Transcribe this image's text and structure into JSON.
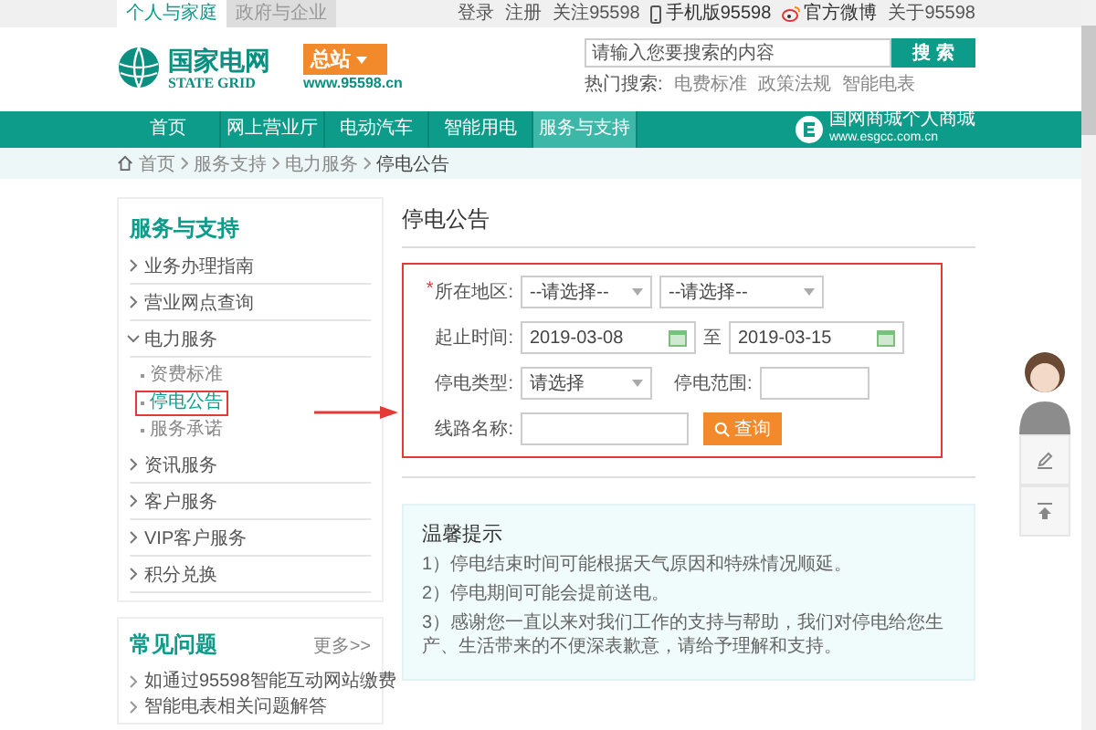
{
  "top_bar": {
    "tabs": [
      {
        "label": "个人与家庭",
        "selected": true
      },
      {
        "label": "政府与企业",
        "selected": false
      }
    ],
    "links": [
      {
        "label": "登录",
        "kind": "plain"
      },
      {
        "label": "注册",
        "kind": "plain"
      },
      {
        "label": "关注95598",
        "kind": "plain"
      },
      {
        "label": "手机版95598",
        "kind": "phone"
      },
      {
        "label": "官方微博",
        "kind": "weibo"
      },
      {
        "label": "关于95598",
        "kind": "plain"
      }
    ]
  },
  "header": {
    "logo_cn": "国家电网",
    "logo_en": "STATE GRID",
    "site_badge": "总站",
    "site_url": "www.95598.cn",
    "search": {
      "placeholder": "请输入您要搜索的内容",
      "button": "搜 索"
    },
    "hot_label": "热门搜索:",
    "hot_terms": [
      "电费标准",
      "政策法规",
      "智能电表"
    ]
  },
  "nav": {
    "items": [
      {
        "label": "首页",
        "selected": false
      },
      {
        "label": "网上营业厅",
        "selected": false
      },
      {
        "label": "电动汽车",
        "selected": false
      },
      {
        "label": "智能用电",
        "selected": false
      },
      {
        "label": "服务与支持",
        "selected": true
      }
    ],
    "mall": {
      "name": "国网商城个人商城",
      "url": "www.esgcc.com.cn"
    }
  },
  "breadcrumb": [
    "首页",
    "服务支持",
    "电力服务",
    "停电公告"
  ],
  "sidebar": {
    "title": "服务与支持",
    "items": [
      {
        "label": "业务办理指南",
        "expanded": false
      },
      {
        "label": "营业网点查询",
        "expanded": false
      },
      {
        "label": "电力服务",
        "expanded": true,
        "children": [
          {
            "label": "资费标准",
            "selected": false,
            "highlighted": false
          },
          {
            "label": "停电公告",
            "selected": true,
            "highlighted": true
          },
          {
            "label": "服务承诺",
            "selected": false,
            "highlighted": false
          }
        ]
      },
      {
        "label": "资讯服务",
        "expanded": false
      },
      {
        "label": "客户服务",
        "expanded": false
      },
      {
        "label": "VIP客户服务",
        "expanded": false
      },
      {
        "label": "积分兑换",
        "expanded": false
      }
    ]
  },
  "faq": {
    "title": "常见问题",
    "more": "更多>>",
    "items": [
      "如通过95598智能互动网站缴费",
      "智能电表相关问题解答"
    ]
  },
  "main": {
    "title": "停电公告",
    "form": {
      "highlighted": true,
      "required_mark": "*",
      "region_label": "所在地区:",
      "region_selects": [
        "--请选择--",
        "--请选择--"
      ],
      "date_label": "起止时间:",
      "date_from": "2019-03-08",
      "date_sep": "至",
      "date_to": "2019-03-15",
      "type_label": "停电类型:",
      "type_select": "请选择",
      "range_label": "停电范围:",
      "line_label": "线路名称:",
      "query_button": "查询"
    },
    "tips": {
      "title": "温馨提示",
      "lines": [
        "1）停电结束时间可能根据天气原因和特殊情况顺延。",
        "2）停电期间可能会提前送电。",
        "3）感谢您一直以来对我们工作的支持与帮助，我们对停电给您生产、生活带来的不便深表歉意，请给予理解和支持。"
      ]
    }
  }
}
